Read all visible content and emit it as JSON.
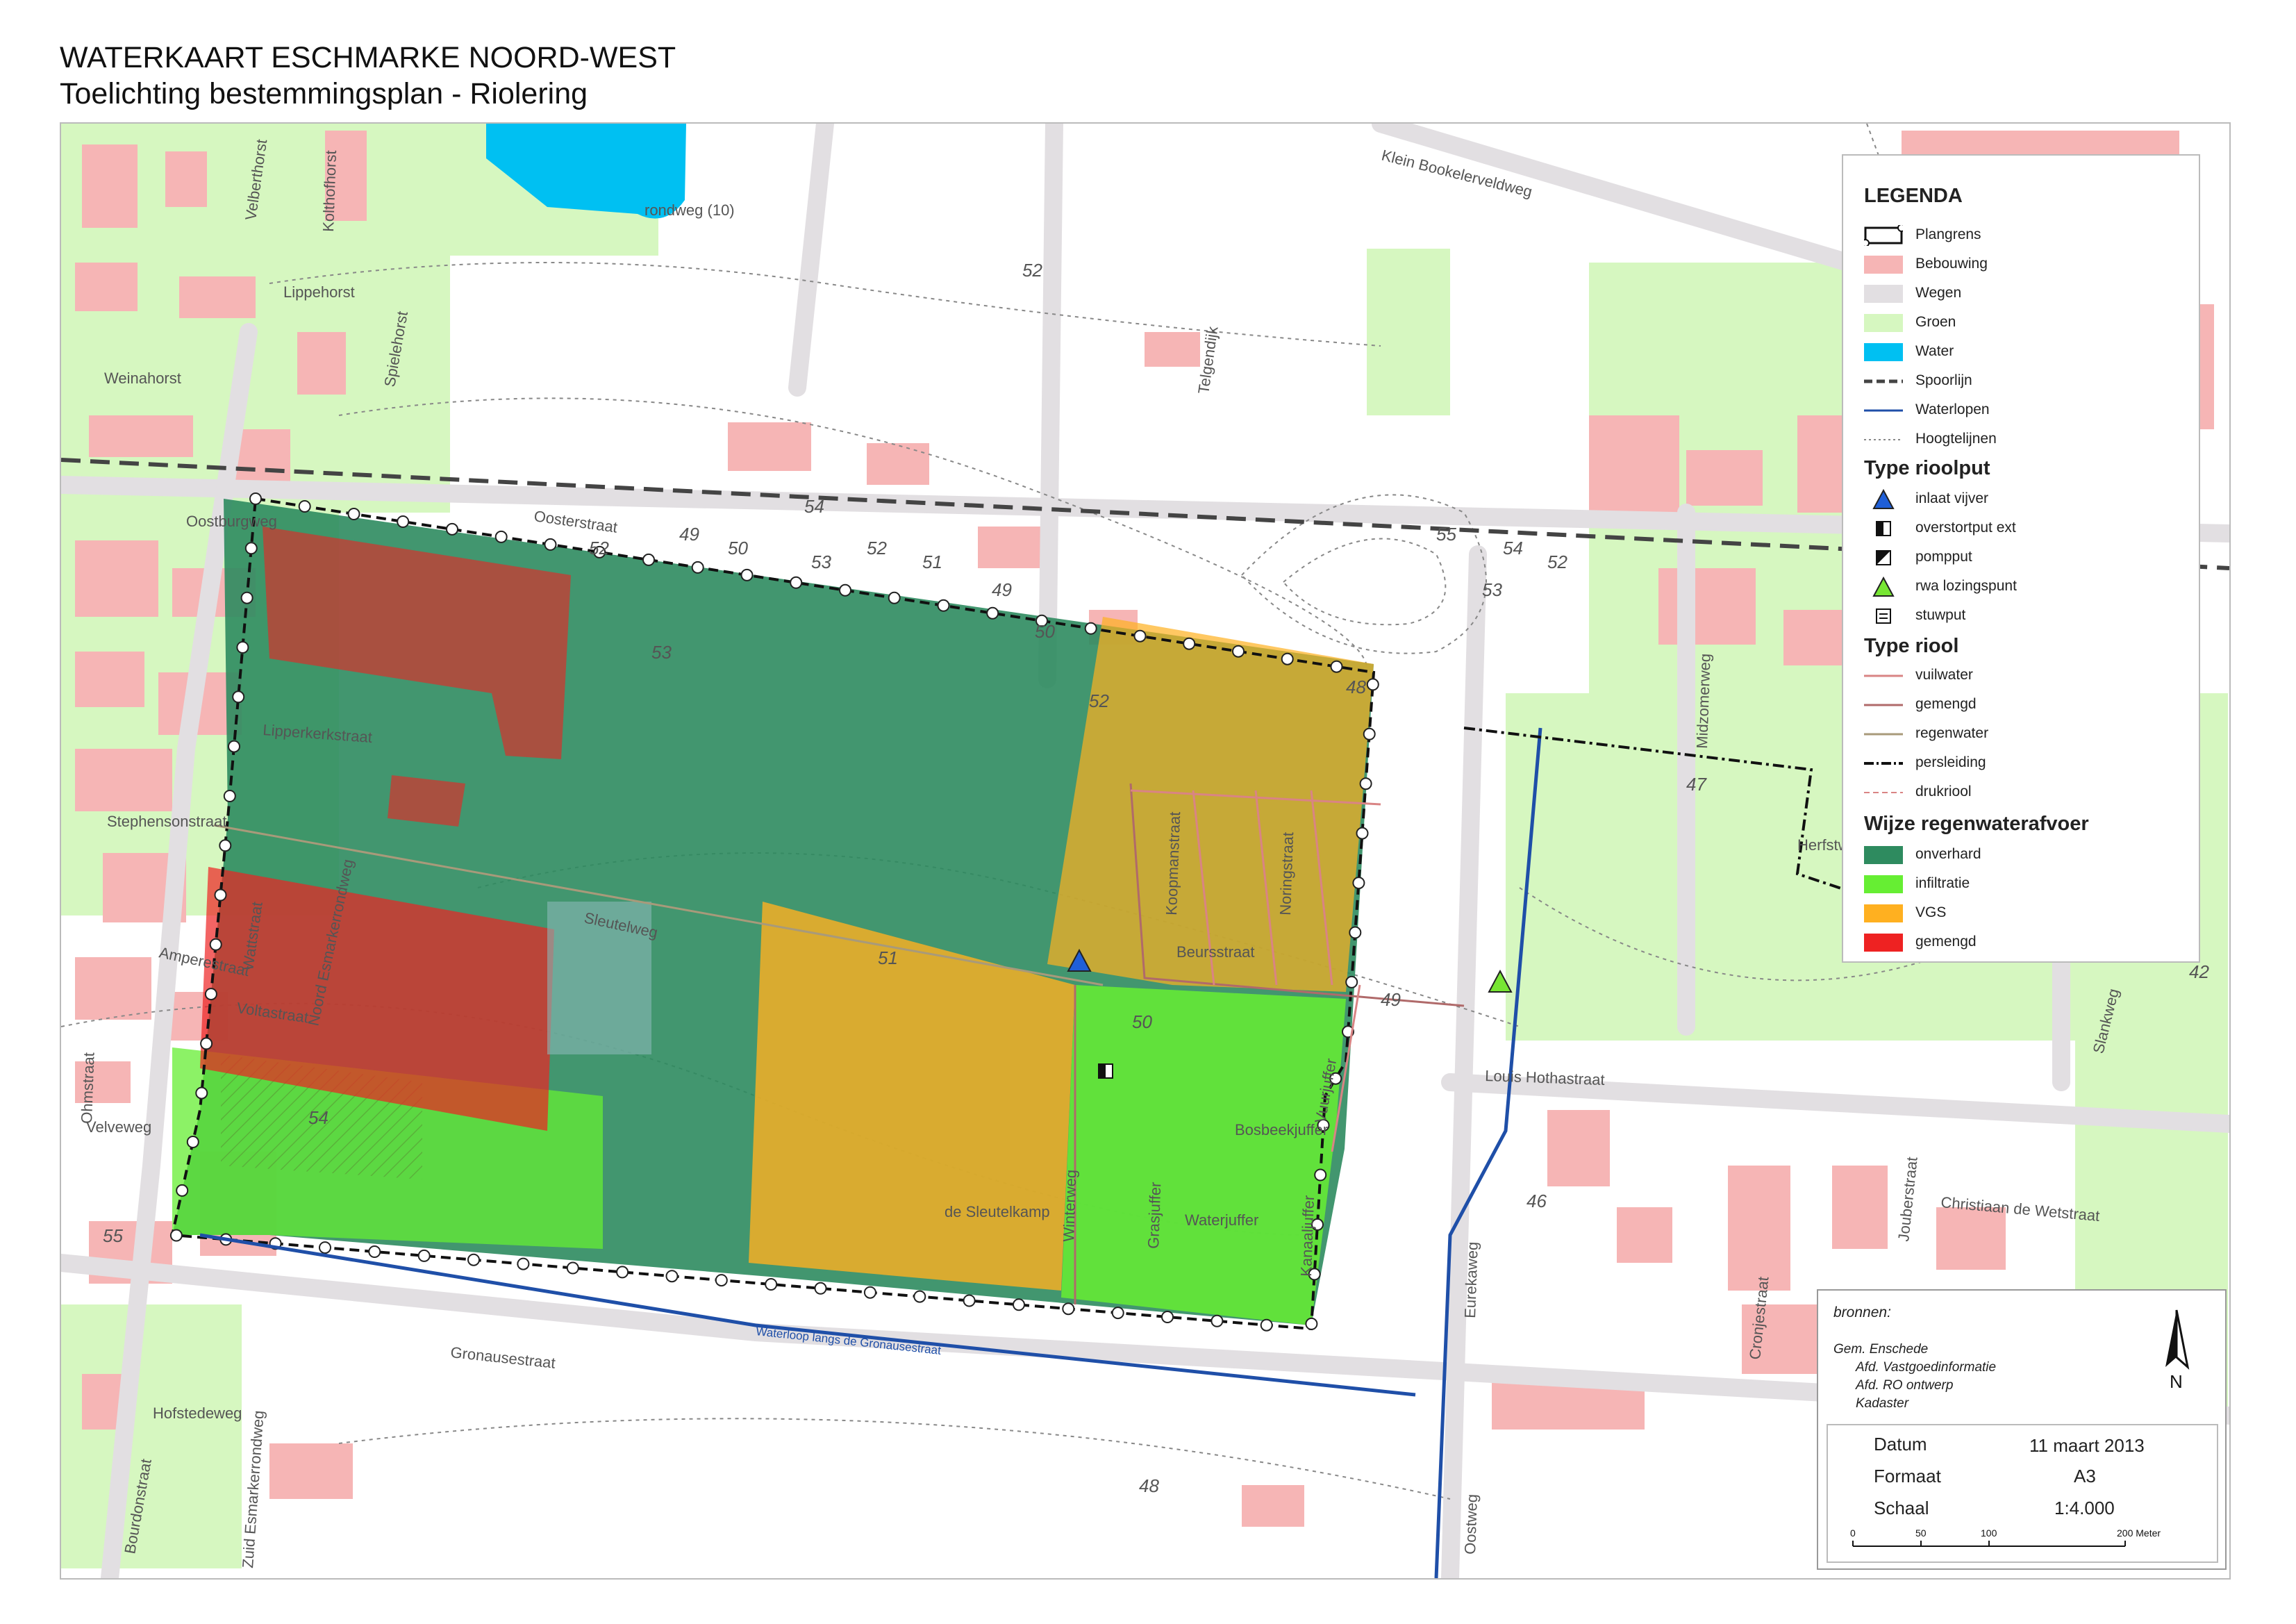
{
  "header": {
    "title": "WATERKAART ESCHMARKE NOORD-WEST",
    "subtitle": "Toelichting bestemmingsplan - Riolering"
  },
  "legend": {
    "title": "LEGENDA",
    "base_items": [
      {
        "label": "Plangrens",
        "symbol": "plangrens"
      },
      {
        "label": "Bebouwing",
        "symbol": "fill",
        "color": "#f6b5b5"
      },
      {
        "label": "Wegen",
        "symbol": "fill",
        "color": "#e2dfe2"
      },
      {
        "label": "Groen",
        "symbol": "fill",
        "color": "#d6f7c0"
      },
      {
        "label": "Water",
        "symbol": "fill",
        "color": "#00c0f2"
      },
      {
        "label": "Spoorlijn",
        "symbol": "rail"
      },
      {
        "label": "Waterlopen",
        "symbol": "line",
        "color": "#1f4fa8"
      },
      {
        "label": "Hoogtelijnen",
        "symbol": "dotted",
        "color": "#888888"
      }
    ],
    "riolput_title": "Type rioolput",
    "riolput_items": [
      {
        "label": "inlaat vijver",
        "symbol": "triangle-blue"
      },
      {
        "label": "overstortput ext",
        "symbol": "half-square"
      },
      {
        "label": "pompput",
        "symbol": "diag-square"
      },
      {
        "label": "rwa lozingspunt",
        "symbol": "triangle-green"
      },
      {
        "label": "stuwput",
        "symbol": "stuw-square"
      }
    ],
    "riool_title": "Type riool",
    "riool_items": [
      {
        "label": "vuilwater",
        "symbol": "line",
        "color": "#d98484"
      },
      {
        "label": "gemengd",
        "symbol": "line",
        "color": "#b06a6a"
      },
      {
        "label": "regenwater",
        "symbol": "line",
        "color": "#a89a7a"
      },
      {
        "label": "persleiding",
        "symbol": "pers"
      },
      {
        "label": "drukriool",
        "symbol": "dashed",
        "color": "#d98484"
      }
    ],
    "afvoer_title": "Wijze regenwaterafvoer",
    "afvoer_items": [
      {
        "label": "onverhard",
        "symbol": "fill",
        "color": "#2e8b5f"
      },
      {
        "label": "infiltratie",
        "symbol": "fill",
        "color": "#66ee33"
      },
      {
        "label": "VGS",
        "symbol": "fill",
        "color": "#ffb020"
      },
      {
        "label": "gemengd",
        "symbol": "fill",
        "color": "#ee2222"
      }
    ]
  },
  "info": {
    "sources_title": "bronnen:",
    "sources": [
      "Gem. Enschede",
      "Afd. Vastgoedinformatie",
      "Afd. RO ontwerp",
      "Kadaster"
    ],
    "north_label": "N",
    "rows": [
      {
        "label": "Datum",
        "value": "11 maart 2013"
      },
      {
        "label": "Formaat",
        "value": "A3"
      },
      {
        "label": "Schaal",
        "value": "1:4.000"
      }
    ],
    "scale_ticks": [
      "0",
      "50",
      "100",
      "200 Meter"
    ]
  },
  "map": {
    "street_labels": [
      "rondweg (10)",
      "Klein Bookelerveldweg",
      "Telgendijk",
      "Lippehorst",
      "Weinahorst",
      "Spielehorst",
      "Kolthofhorst",
      "Velberthorst",
      "Oostburgweg",
      "Oosterstraat",
      "Lipperkerkstraat",
      "Stephensonstraat",
      "Sleutelweg",
      "Amperestraat",
      "Voltastraat",
      "Wattstraat",
      "Noord Esmarkerrondweg",
      "Ohmstraat",
      "Velveweg",
      "Gronausestraat",
      "Hofstedeweg",
      "Bourdonstraat",
      "Zuid Esmarkerrondweg",
      "Koopmanstraat",
      "Noringstraat",
      "Beursstraat",
      "Winterweg",
      "de Sleutelkamp",
      "Bosbeekjuffer",
      "Waterjuffer",
      "Grasjuffer",
      "Kanaaljuffer",
      "Vuurjuffer",
      "Louis Hothastraat",
      "Eurekaweg",
      "Oostweg",
      "Herfstweg",
      "Midzomerweg",
      "Christiaan de Wetstraat",
      "Jouberstraat",
      "Cronjestraat",
      "Slankweg",
      "Waterloop langs de Gronausestraat"
    ],
    "contour_labels": [
      "52",
      "54",
      "55",
      "54",
      "52",
      "53",
      "53",
      "52",
      "52",
      "50",
      "49",
      "51",
      "52",
      "51",
      "50",
      "49",
      "54",
      "55",
      "46",
      "47",
      "48",
      "42",
      "48",
      "49",
      "50",
      "53"
    ]
  }
}
